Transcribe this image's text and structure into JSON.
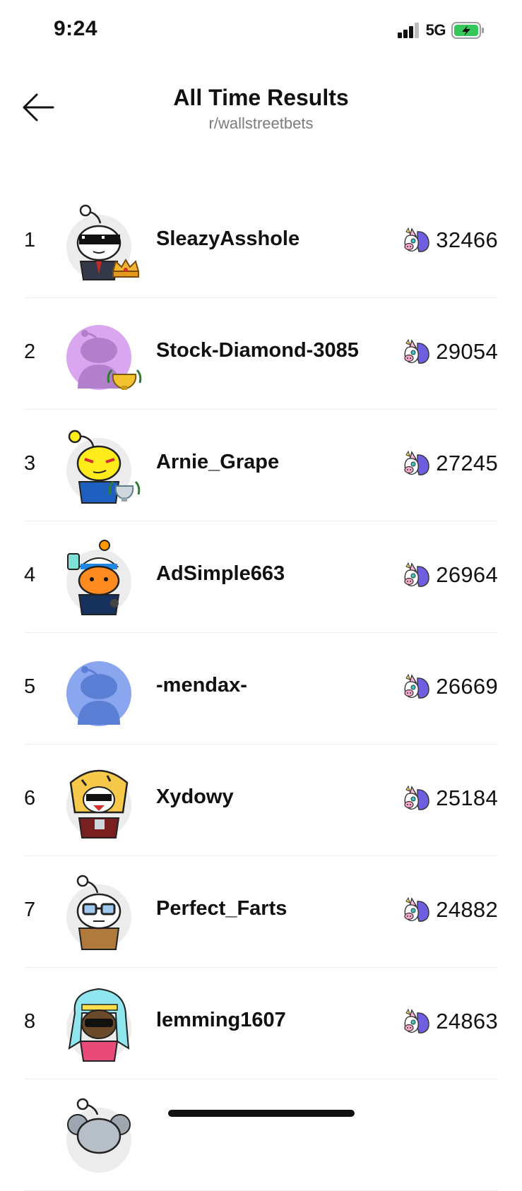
{
  "status_bar": {
    "time": "9:24",
    "network": "5G",
    "battery_state": "charging"
  },
  "header": {
    "title": "All Time Results",
    "subtitle": "r/wallstreetbets",
    "back_icon": "arrow-left-icon"
  },
  "colors": {
    "text": "#111111",
    "subtitle": "#7c7c7c",
    "battery": "#34c759",
    "divider": "#ededed"
  },
  "leaderboard": [
    {
      "rank": "1",
      "username": "SleazyAsshole",
      "score": "32466",
      "trophy": "crown"
    },
    {
      "rank": "2",
      "username": "Stock-Diamond-3085",
      "score": "29054",
      "trophy": "gold-trophy"
    },
    {
      "rank": "3",
      "username": "Arnie_Grape",
      "score": "27245",
      "trophy": "silver-trophy"
    },
    {
      "rank": "4",
      "username": "AdSimple663",
      "score": "26964",
      "trophy": ""
    },
    {
      "rank": "5",
      "username": "-mendax-",
      "score": "26669",
      "trophy": ""
    },
    {
      "rank": "6",
      "username": "Xydowy",
      "score": "25184",
      "trophy": ""
    },
    {
      "rank": "7",
      "username": "Perfect_Farts",
      "score": "24882",
      "trophy": ""
    },
    {
      "rank": "8",
      "username": "lemming1607",
      "score": "24863",
      "trophy": ""
    }
  ]
}
